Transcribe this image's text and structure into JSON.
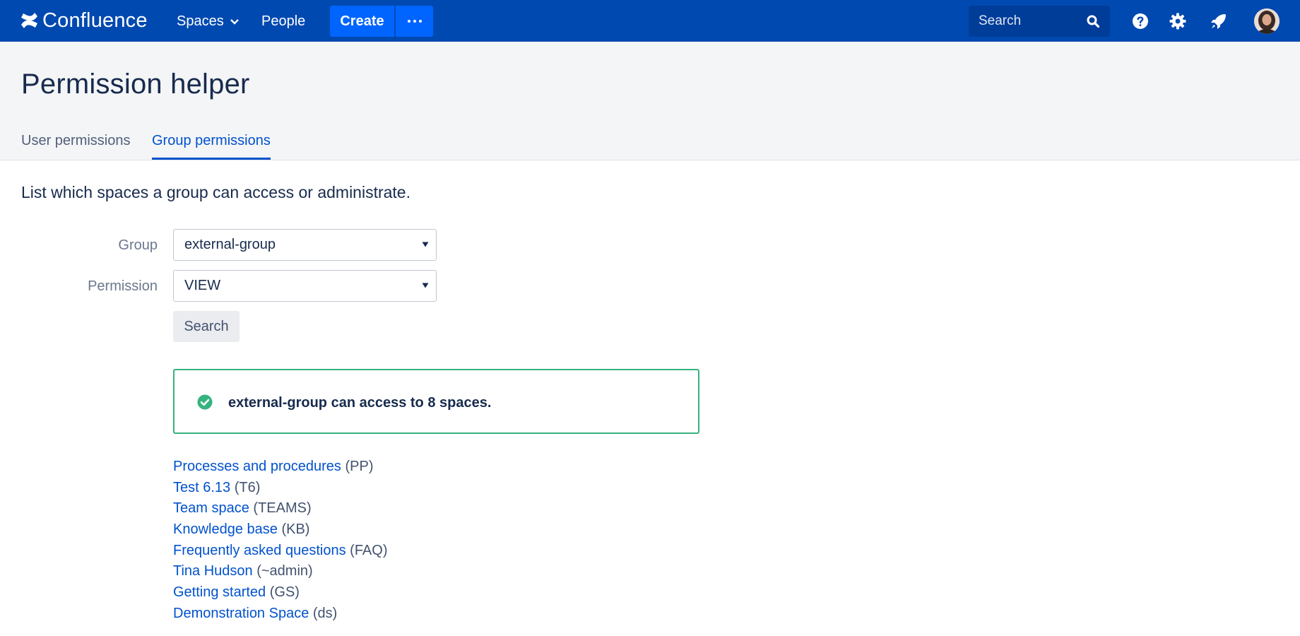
{
  "topbar": {
    "logo_text": "Confluence",
    "spaces_label": "Spaces",
    "people_label": "People",
    "create_label": "Create",
    "search_placeholder": "Search",
    "colors": {
      "bar": "#0049b0",
      "button": "#0065ff",
      "search": "#003d99"
    },
    "icons": [
      "confluence-logo-icon",
      "chevron-down-icon",
      "more-icon",
      "search-icon",
      "help-icon",
      "gear-icon",
      "notification-icon",
      "avatar"
    ]
  },
  "header": {
    "title": "Permission helper",
    "tabs": [
      {
        "label": "User permissions",
        "active": false
      },
      {
        "label": "Group permissions",
        "active": true
      }
    ]
  },
  "form": {
    "intro": "List which spaces a group can access or administrate.",
    "group_label": "Group",
    "group_value": "external-group",
    "permission_label": "Permission",
    "permission_value": "VIEW",
    "search_button": "Search"
  },
  "result": {
    "message": "external-group can access to 8 spaces.",
    "status_color": "#36b37e"
  },
  "spaces": [
    {
      "name": "Processes and procedures",
      "key": "(PP)"
    },
    {
      "name": "Test 6.13",
      "key": "(T6)"
    },
    {
      "name": "Team space",
      "key": "(TEAMS)"
    },
    {
      "name": "Knowledge base",
      "key": "(KB)"
    },
    {
      "name": "Frequently asked questions",
      "key": "(FAQ)"
    },
    {
      "name": "Tina Hudson",
      "key": "(~admin)"
    },
    {
      "name": "Getting started",
      "key": "(GS)"
    },
    {
      "name": "Demonstration Space",
      "key": "(ds)"
    }
  ]
}
